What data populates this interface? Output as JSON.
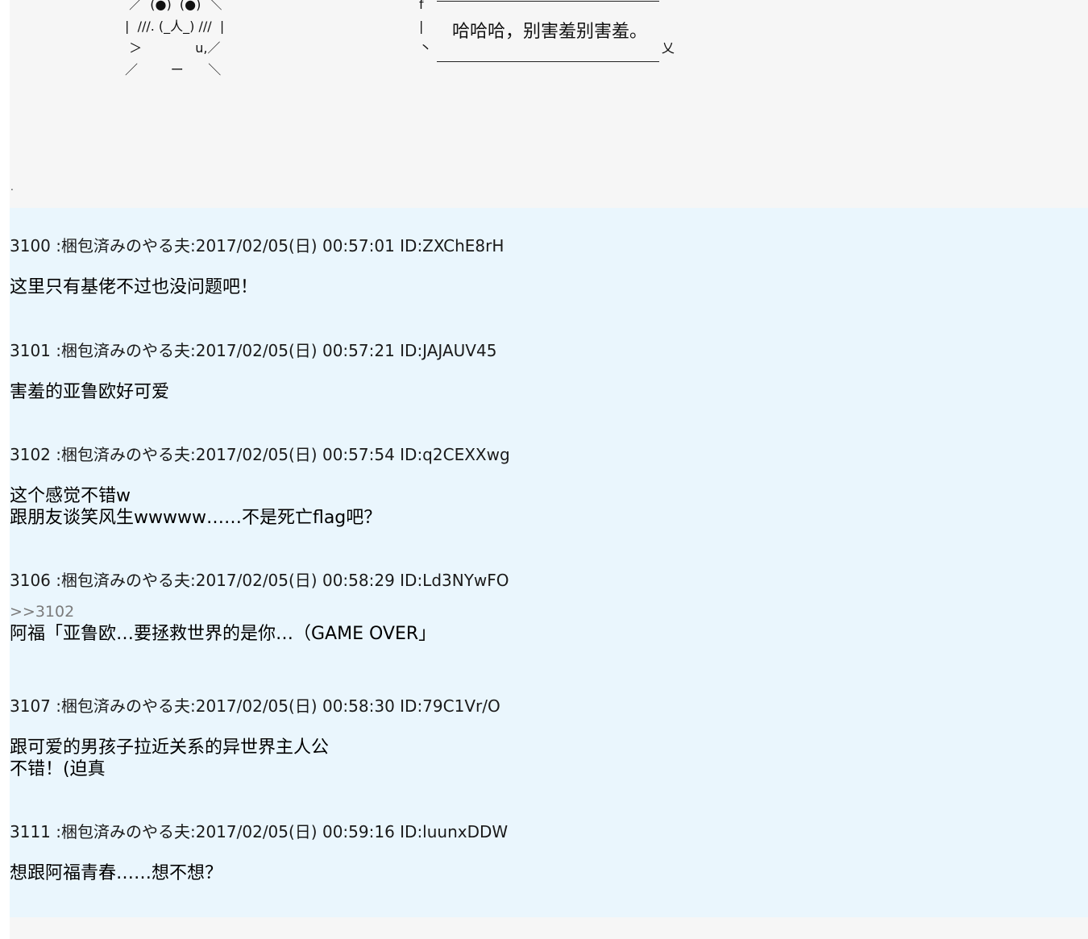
{
  "ascii_art": {
    "face": " ／  (●)  (●)  ＼\n|  ///. (_人_) ///  |\n ＞             u,／\n／        ー      ＼",
    "bubble_frame": "f\n|\n丶                                                        乂",
    "bubble_text": "哈哈哈，别害羞别害羞。",
    "stray_mark": "."
  },
  "posts": [
    {
      "number": "3100",
      "header": "3100 :梱包済みのやる夫:2017/02/05(日) 00:57:01 ID:ZXChE8rH",
      "lines": [
        "这里只有基佬不过也没问题吧！"
      ]
    },
    {
      "number": "3101",
      "header": "3101 :梱包済みのやる夫:2017/02/05(日) 00:57:21 ID:JAJAUV45",
      "lines": [
        "害羞的亚鲁欧好可爱"
      ]
    },
    {
      "number": "3102",
      "header": "3102 :梱包済みのやる夫:2017/02/05(日) 00:57:54 ID:q2CEXXwg",
      "lines": [
        "这个感觉不错w",
        "跟朋友谈笑风生wwwww……不是死亡flag吧？"
      ]
    },
    {
      "number": "3106",
      "header": "3106 :梱包済みのやる夫:2017/02/05(日) 00:58:29 ID:Ld3NYwFO",
      "anchor": ">>3102",
      "lines": [
        "阿福「亚鲁欧…要拯救世界的是你…（GAME OVER」"
      ]
    },
    {
      "number": "3107",
      "header": "3107 :梱包済みのやる夫:2017/02/05(日) 00:58:30 ID:79C1Vr/O",
      "lines": [
        "跟可爱的男孩子拉近关系的异世界主人公",
        "不错！(迫真"
      ]
    },
    {
      "number": "3111",
      "header": "3111 :梱包済みのやる夫:2017/02/05(日) 00:59:16 ID:luunxDDW",
      "lines": [
        "想跟阿福青春……想不想？"
      ]
    }
  ]
}
